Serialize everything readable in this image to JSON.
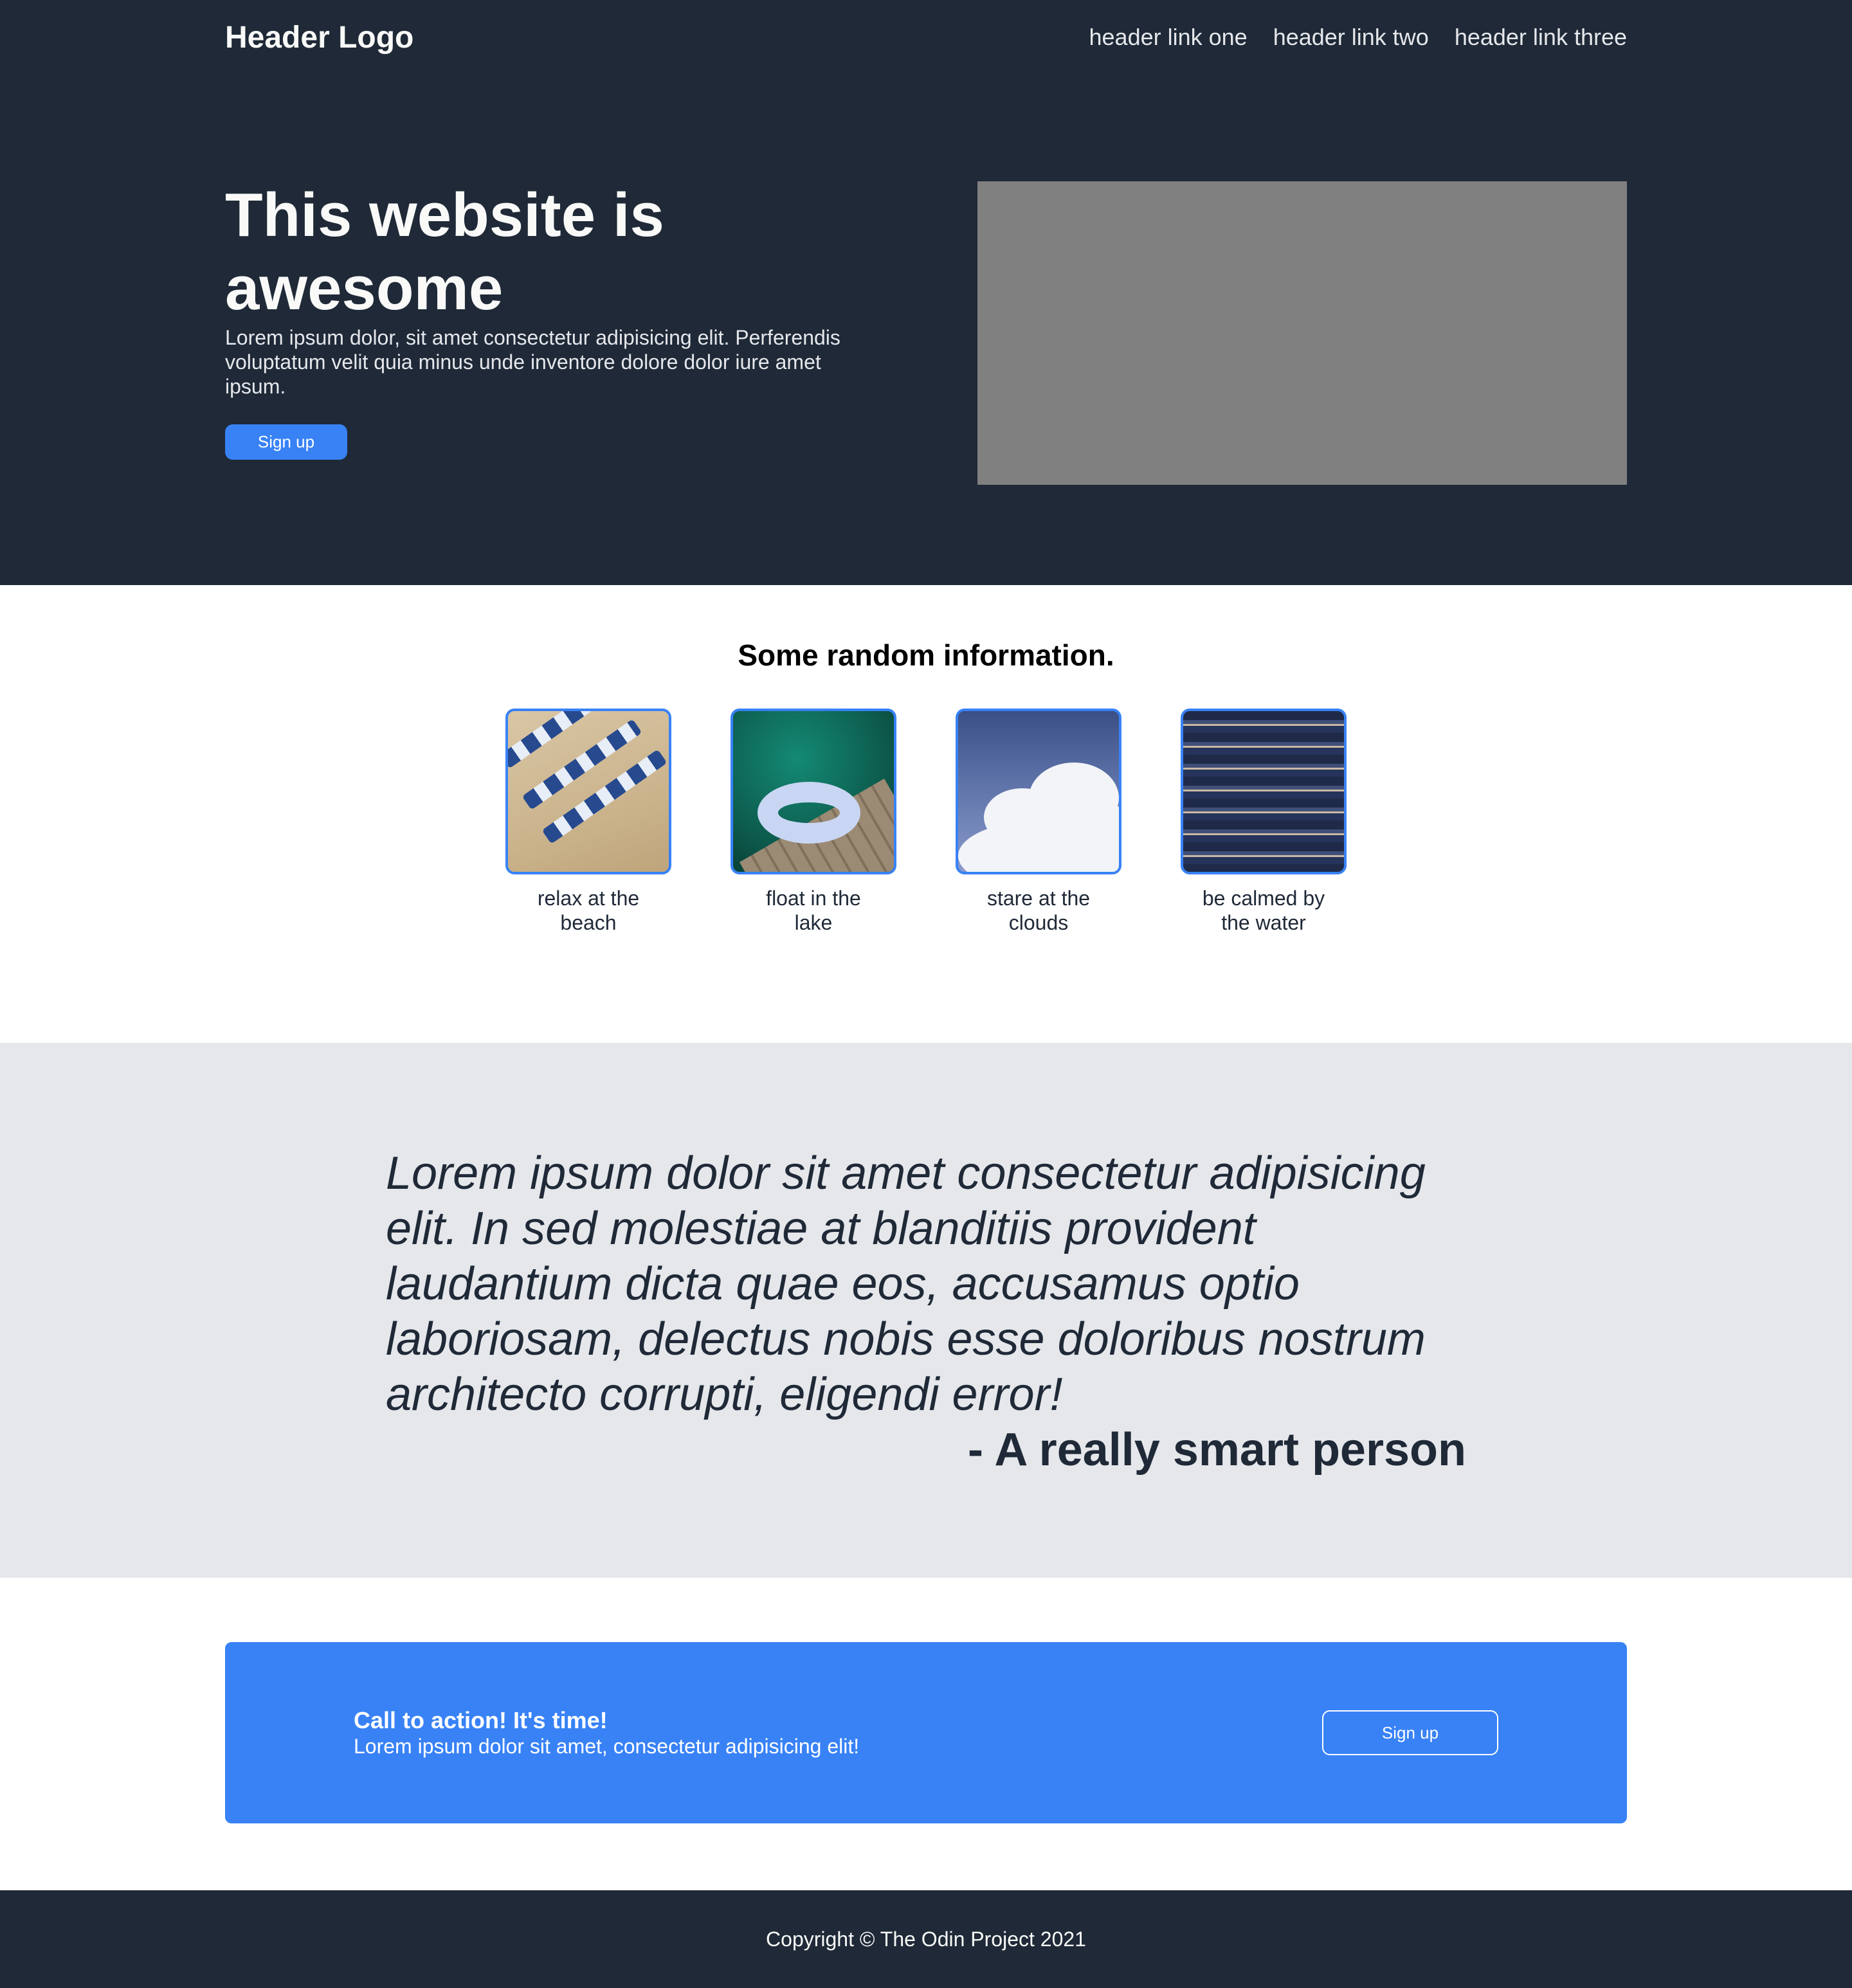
{
  "header": {
    "logo": "Header Logo",
    "links": [
      "header link one",
      "header link two",
      "header link three"
    ]
  },
  "hero": {
    "title": "This website is awesome",
    "text": "Lorem ipsum dolor, sit amet consectetur adipisicing elit. Perferendis voluptatum velit quia minus unde inventore dolore dolor iure amet ipsum.",
    "button": "Sign up"
  },
  "info": {
    "title": "Some random information.",
    "cards": [
      {
        "label": "relax at the beach",
        "icon": "beach-image"
      },
      {
        "label": "float in the lake",
        "icon": "lake-image"
      },
      {
        "label": "stare at the clouds",
        "icon": "clouds-image"
      },
      {
        "label": "be calmed by the water",
        "icon": "water-image"
      }
    ]
  },
  "quote": {
    "text": "Lorem ipsum dolor sit amet consectetur adipisicing elit. In sed molestiae at blanditiis provident laudantium dicta quae eos, accusamus optio laboriosam, delectus nobis esse doloribus nostrum architecto corrupti, eligendi error!",
    "author": "- A really smart person"
  },
  "cta": {
    "title": "Call to action! It's time!",
    "text": "Lorem ipsum dolor sit amet, consectetur adipisicing elit!",
    "button": "Sign up"
  },
  "footer": {
    "text": "Copyright © The Odin Project 2021"
  },
  "colors": {
    "dark": "#1f2937",
    "accent": "#3882f6",
    "light_gray": "#e5e7eb",
    "placeholder": "#808080"
  }
}
